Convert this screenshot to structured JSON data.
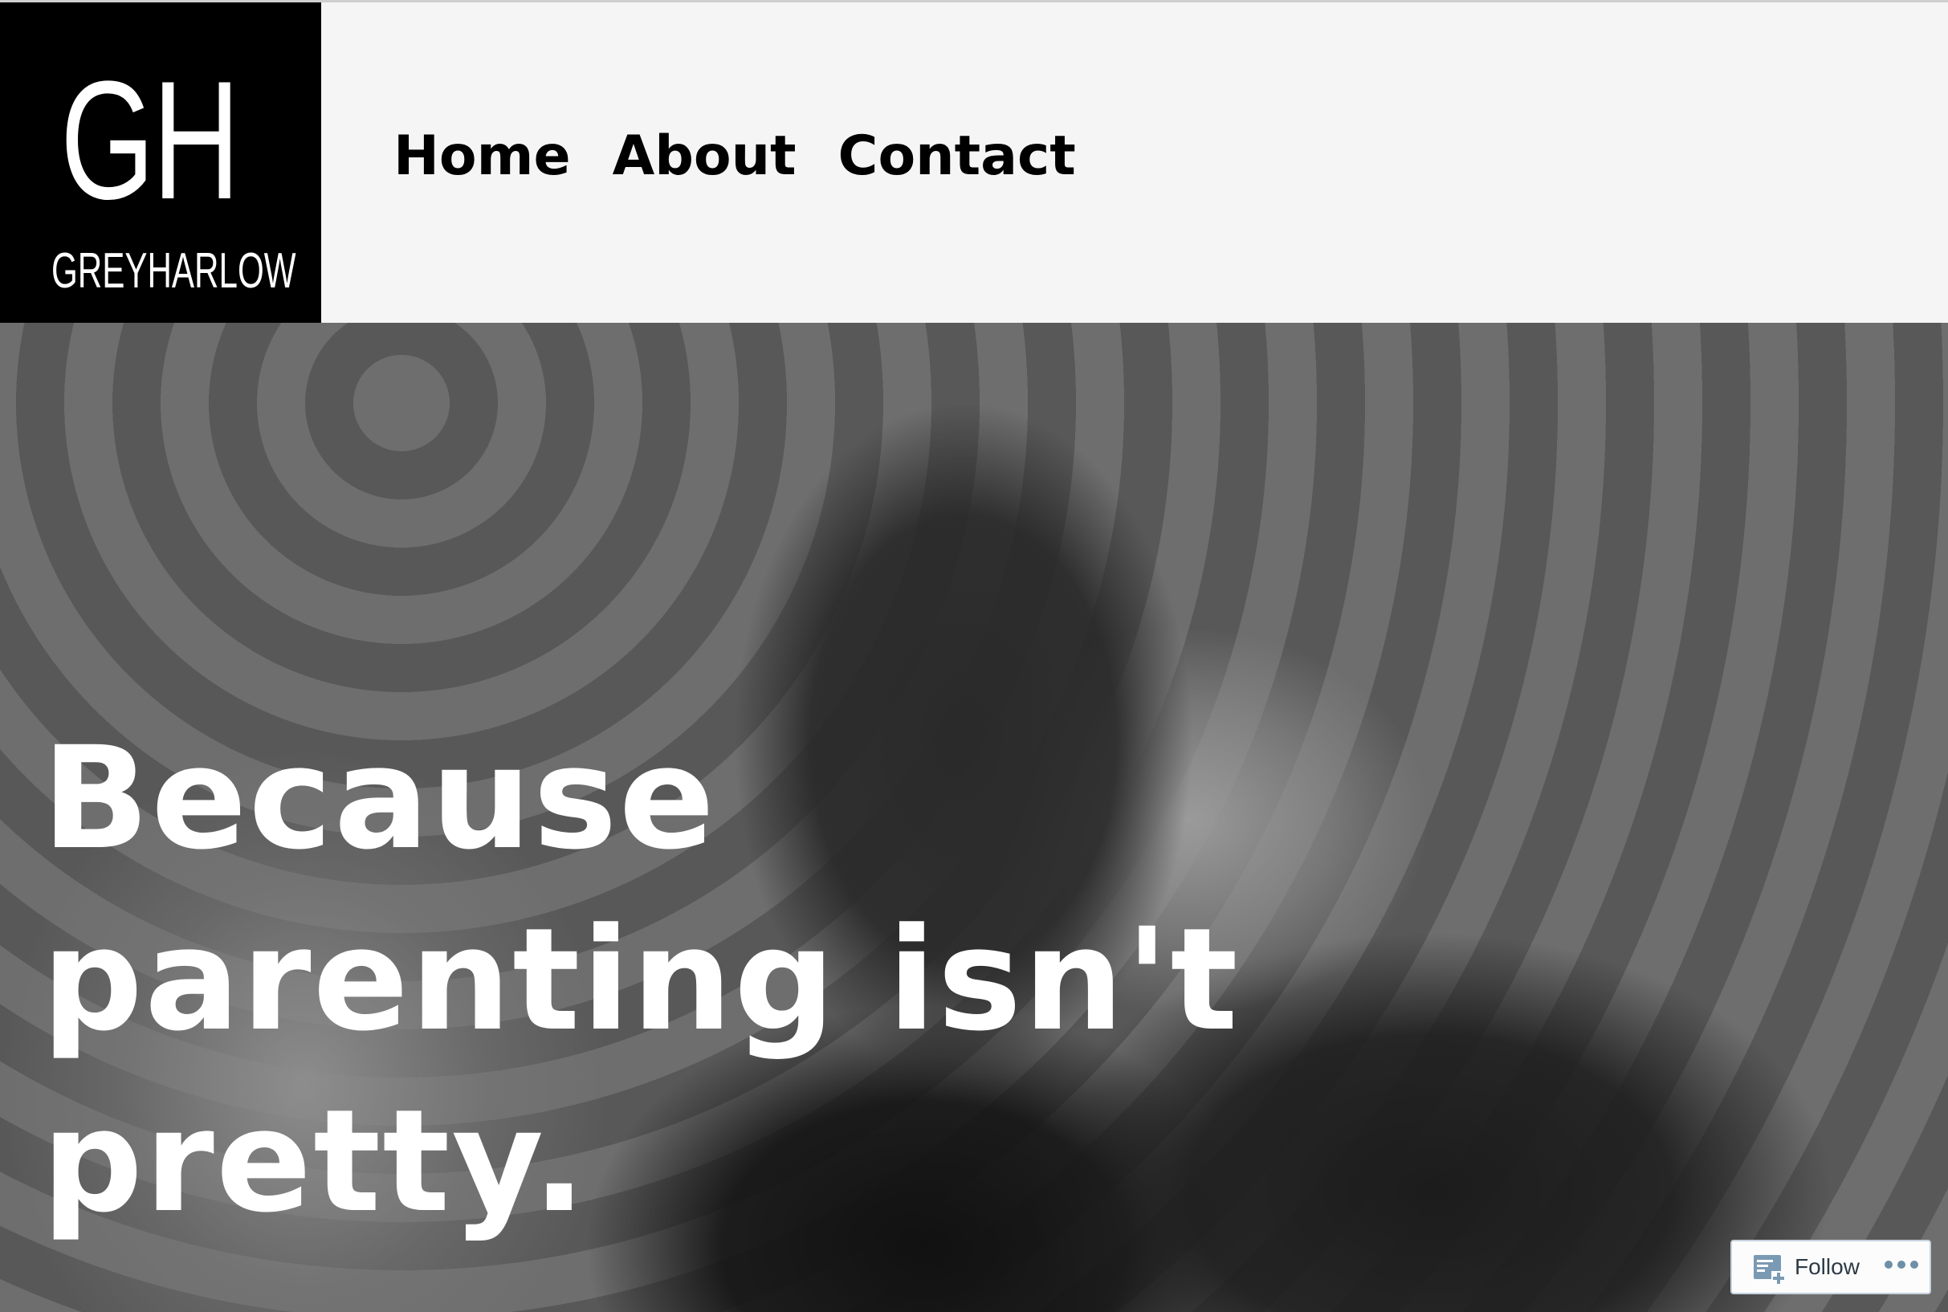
{
  "logo": {
    "monogram": "GH",
    "wordmark": "GREYHARLOW"
  },
  "nav": {
    "items": [
      {
        "label": "Home"
      },
      {
        "label": "About"
      },
      {
        "label": "Contact"
      }
    ]
  },
  "hero": {
    "headline": "Because parenting isn't pretty."
  },
  "follow_widget": {
    "label": "Follow",
    "icon": "reader-follow-icon",
    "more_icon": "ellipsis-icon",
    "accent": "#6e8fa8"
  }
}
